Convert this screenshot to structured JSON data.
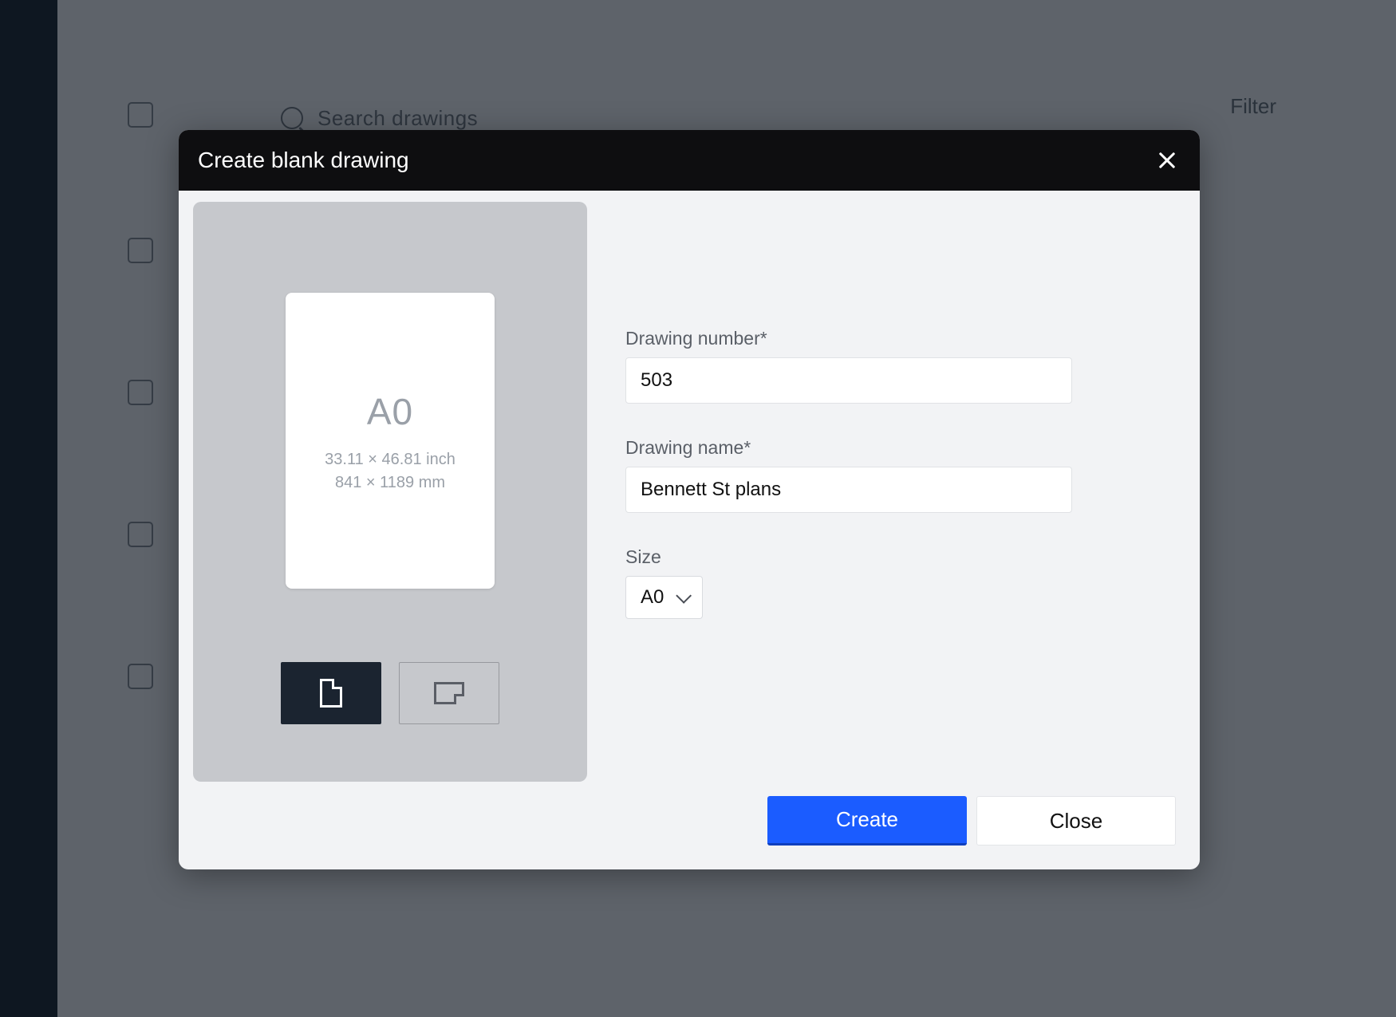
{
  "background": {
    "search_placeholder": "Search drawings",
    "filter_label": "Filter"
  },
  "modal": {
    "title": "Create blank drawing",
    "preview": {
      "size_name": "A0",
      "dim_inch": "33.11 × 46.81 inch",
      "dim_mm": "841 × 1189 mm"
    },
    "form": {
      "drawing_number_label": "Drawing number*",
      "drawing_number_value": "503",
      "drawing_name_label": "Drawing name*",
      "drawing_name_value": "Bennett St plans",
      "size_label": "Size",
      "size_value": "A0"
    },
    "buttons": {
      "create": "Create",
      "close": "Close"
    }
  }
}
